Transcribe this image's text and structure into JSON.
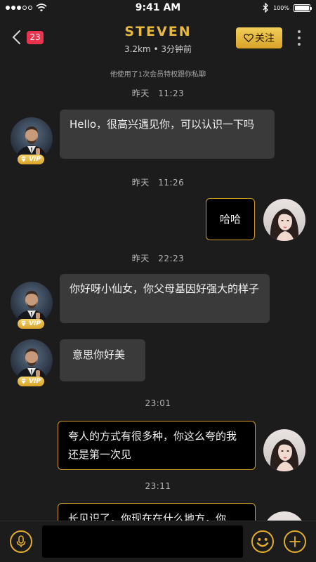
{
  "status_bar": {
    "time": "9:41 AM",
    "battery_pct": "100%",
    "battery_level": 1.0,
    "icons": [
      "signal-dots-icon",
      "wifi-icon",
      "bluetooth-icon",
      "battery-icon"
    ]
  },
  "header": {
    "back_icon": "chevron-left-icon",
    "unread_count": "23",
    "title": "STEVEN",
    "subtitle": "3.2km  •  3分钟前",
    "follow_label": "关注",
    "follow_icon": "heart-outline-icon",
    "more_icon": "vertical-dots-icon"
  },
  "chat": {
    "privilege_note": "他使用了1次会员特权跟你私聊",
    "timestamps": [
      "昨天　11:23",
      "昨天　11:26",
      "昨天　22:23",
      "23:01",
      "23:11"
    ],
    "vip_label": "VIP",
    "messages": [
      {
        "from": "them",
        "text": "Hello，很高兴遇见你，可以认识一下吗"
      },
      {
        "from": "me",
        "text": "哈哈"
      },
      {
        "from": "them",
        "text": "你好呀小仙女，你父母基因好强大的样子"
      },
      {
        "from": "them",
        "text": "意思你好美"
      },
      {
        "from": "me",
        "text": "夸人的方式有很多种，你这么夸的我还是第一次见"
      },
      {
        "from": "me",
        "text": "长见识了，你现在在什么地方，你"
      }
    ]
  },
  "input_bar": {
    "voice_icon": "microphone-icon",
    "emoji_icon": "smiley-icon",
    "add_icon": "plus-icon",
    "placeholder": ""
  },
  "colors": {
    "background": "#1c1c1c",
    "accent_gold": "#e9b83f",
    "incoming_bubble": "#3a3a3a",
    "outgoing_bubble": "#000000",
    "outgoing_border": "#d09b2c",
    "badge_red": "#e8344e"
  }
}
